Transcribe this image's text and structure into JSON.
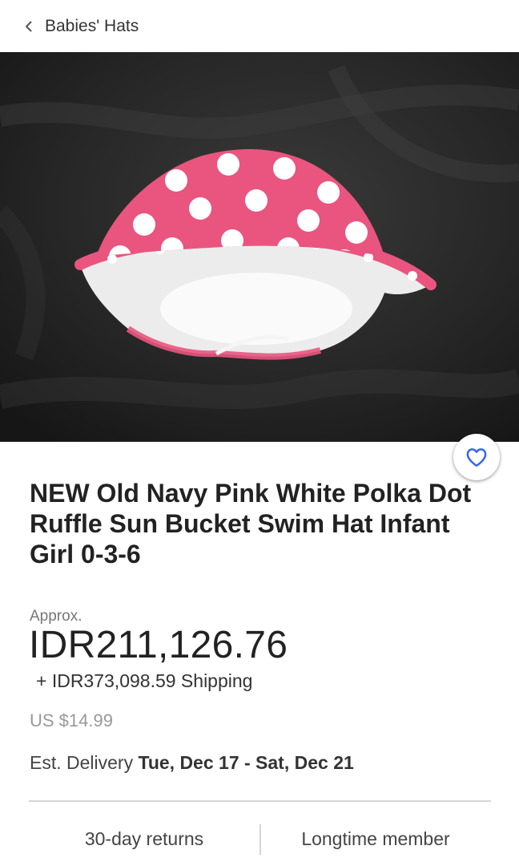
{
  "header": {
    "back_label": "Babies' Hats"
  },
  "product": {
    "image_alt": "Pink and white polka dot ruffle sun bucket hat on a dark background",
    "title": "NEW Old Navy Pink White Polka Dot Ruffle Sun Bucket Swim Hat Infant Girl 0-3-6",
    "approx_label": "Approx.",
    "price": "IDR211,126.76",
    "shipping": "+ IDR373,098.59 Shipping",
    "original_price": "US $14.99",
    "delivery_label": "Est. Delivery",
    "delivery_dates": "Tue, Dec 17 - Sat, Dec 21"
  },
  "badges": {
    "returns": "30-day returns",
    "member": "Longtime member"
  },
  "icons": {
    "back": "chevron-left-icon",
    "watch": "heart-icon"
  },
  "colors": {
    "accent": "#3665f3",
    "hat_pink": "#e9557f",
    "background_fabric": "#1e1e1e"
  }
}
